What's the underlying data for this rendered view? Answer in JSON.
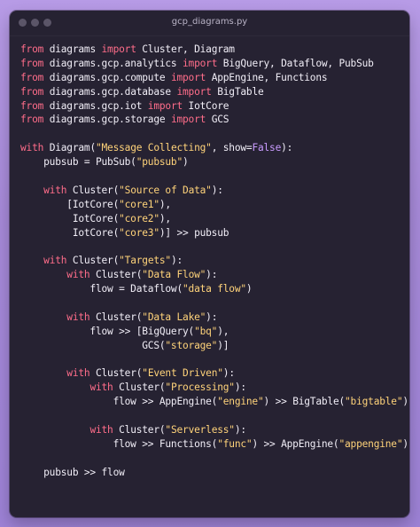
{
  "window": {
    "title": "gcp_diagrams.py",
    "traffic_lights": [
      "close",
      "minimize",
      "zoom"
    ]
  },
  "colors": {
    "background": "#a78ad9",
    "editor_background": "#262232",
    "keyword": "#ff6d8a",
    "string": "#ffd37a",
    "boolean": "#c99cff",
    "text": "#f1eef7"
  },
  "code_lines": [
    [
      {
        "t": "from",
        "c": "kw"
      },
      {
        "t": " diagrams ",
        "c": "fn"
      },
      {
        "t": "import",
        "c": "kw"
      },
      {
        "t": " Cluster, Diagram",
        "c": "fn"
      }
    ],
    [
      {
        "t": "from",
        "c": "kw"
      },
      {
        "t": " diagrams.gcp.analytics ",
        "c": "fn"
      },
      {
        "t": "import",
        "c": "kw"
      },
      {
        "t": " BigQuery, Dataflow, PubSub",
        "c": "fn"
      }
    ],
    [
      {
        "t": "from",
        "c": "kw"
      },
      {
        "t": " diagrams.gcp.compute ",
        "c": "fn"
      },
      {
        "t": "import",
        "c": "kw"
      },
      {
        "t": " AppEngine, Functions",
        "c": "fn"
      }
    ],
    [
      {
        "t": "from",
        "c": "kw"
      },
      {
        "t": " diagrams.gcp.database ",
        "c": "fn"
      },
      {
        "t": "import",
        "c": "kw"
      },
      {
        "t": " BigTable",
        "c": "fn"
      }
    ],
    [
      {
        "t": "from",
        "c": "kw"
      },
      {
        "t": " diagrams.gcp.iot ",
        "c": "fn"
      },
      {
        "t": "import",
        "c": "kw"
      },
      {
        "t": " IotCore",
        "c": "fn"
      }
    ],
    [
      {
        "t": "from",
        "c": "kw"
      },
      {
        "t": " diagrams.gcp.storage ",
        "c": "fn"
      },
      {
        "t": "import",
        "c": "kw"
      },
      {
        "t": " GCS",
        "c": "fn"
      }
    ],
    [],
    [
      {
        "t": "with",
        "c": "kw"
      },
      {
        "t": " Diagram(",
        "c": "fn"
      },
      {
        "t": "\"Message Collecting\"",
        "c": "str"
      },
      {
        "t": ", show=",
        "c": "fn"
      },
      {
        "t": "False",
        "c": "bool"
      },
      {
        "t": "):",
        "c": "fn"
      }
    ],
    [
      {
        "t": "    pubsub = PubSub(",
        "c": "fn"
      },
      {
        "t": "\"pubsub\"",
        "c": "str"
      },
      {
        "t": ")",
        "c": "fn"
      }
    ],
    [],
    [
      {
        "t": "    ",
        "c": "fn"
      },
      {
        "t": "with",
        "c": "kw"
      },
      {
        "t": " Cluster(",
        "c": "fn"
      },
      {
        "t": "\"Source of Data\"",
        "c": "str"
      },
      {
        "t": "):",
        "c": "fn"
      }
    ],
    [
      {
        "t": "        [IotCore(",
        "c": "fn"
      },
      {
        "t": "\"core1\"",
        "c": "str"
      },
      {
        "t": "),",
        "c": "fn"
      }
    ],
    [
      {
        "t": "         IotCore(",
        "c": "fn"
      },
      {
        "t": "\"core2\"",
        "c": "str"
      },
      {
        "t": "),",
        "c": "fn"
      }
    ],
    [
      {
        "t": "         IotCore(",
        "c": "fn"
      },
      {
        "t": "\"core3\"",
        "c": "str"
      },
      {
        "t": ")] >> pubsub",
        "c": "fn"
      }
    ],
    [],
    [
      {
        "t": "    ",
        "c": "fn"
      },
      {
        "t": "with",
        "c": "kw"
      },
      {
        "t": " Cluster(",
        "c": "fn"
      },
      {
        "t": "\"Targets\"",
        "c": "str"
      },
      {
        "t": "):",
        "c": "fn"
      }
    ],
    [
      {
        "t": "        ",
        "c": "fn"
      },
      {
        "t": "with",
        "c": "kw"
      },
      {
        "t": " Cluster(",
        "c": "fn"
      },
      {
        "t": "\"Data Flow\"",
        "c": "str"
      },
      {
        "t": "):",
        "c": "fn"
      }
    ],
    [
      {
        "t": "            flow = Dataflow(",
        "c": "fn"
      },
      {
        "t": "\"data flow\"",
        "c": "str"
      },
      {
        "t": ")",
        "c": "fn"
      }
    ],
    [],
    [
      {
        "t": "        ",
        "c": "fn"
      },
      {
        "t": "with",
        "c": "kw"
      },
      {
        "t": " Cluster(",
        "c": "fn"
      },
      {
        "t": "\"Data Lake\"",
        "c": "str"
      },
      {
        "t": "):",
        "c": "fn"
      }
    ],
    [
      {
        "t": "            flow >> [BigQuery(",
        "c": "fn"
      },
      {
        "t": "\"bq\"",
        "c": "str"
      },
      {
        "t": "),",
        "c": "fn"
      }
    ],
    [
      {
        "t": "                     GCS(",
        "c": "fn"
      },
      {
        "t": "\"storage\"",
        "c": "str"
      },
      {
        "t": ")]",
        "c": "fn"
      }
    ],
    [],
    [
      {
        "t": "        ",
        "c": "fn"
      },
      {
        "t": "with",
        "c": "kw"
      },
      {
        "t": " Cluster(",
        "c": "fn"
      },
      {
        "t": "\"Event Driven\"",
        "c": "str"
      },
      {
        "t": "):",
        "c": "fn"
      }
    ],
    [
      {
        "t": "            ",
        "c": "fn"
      },
      {
        "t": "with",
        "c": "kw"
      },
      {
        "t": " Cluster(",
        "c": "fn"
      },
      {
        "t": "\"Processing\"",
        "c": "str"
      },
      {
        "t": "):",
        "c": "fn"
      }
    ],
    [
      {
        "t": "                flow >> AppEngine(",
        "c": "fn"
      },
      {
        "t": "\"engine\"",
        "c": "str"
      },
      {
        "t": ") >> BigTable(",
        "c": "fn"
      },
      {
        "t": "\"bigtable\"",
        "c": "str"
      },
      {
        "t": ")",
        "c": "fn"
      }
    ],
    [],
    [
      {
        "t": "            ",
        "c": "fn"
      },
      {
        "t": "with",
        "c": "kw"
      },
      {
        "t": " Cluster(",
        "c": "fn"
      },
      {
        "t": "\"Serverless\"",
        "c": "str"
      },
      {
        "t": "):",
        "c": "fn"
      }
    ],
    [
      {
        "t": "                flow >> Functions(",
        "c": "fn"
      },
      {
        "t": "\"func\"",
        "c": "str"
      },
      {
        "t": ") >> AppEngine(",
        "c": "fn"
      },
      {
        "t": "\"appengine\"",
        "c": "str"
      },
      {
        "t": ")",
        "c": "fn"
      }
    ],
    [],
    [
      {
        "t": "    pubsub >> flow",
        "c": "fn"
      }
    ]
  ]
}
